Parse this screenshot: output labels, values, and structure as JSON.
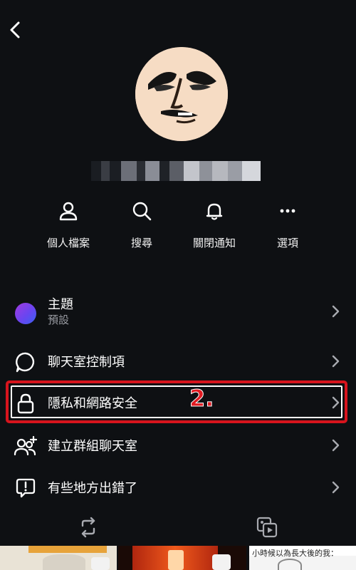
{
  "header": {
    "back_icon": "chevron-left-icon"
  },
  "profile": {
    "name": ""
  },
  "actions": [
    {
      "label": "個人檔案",
      "icon": "person-icon"
    },
    {
      "label": "搜尋",
      "icon": "search-icon"
    },
    {
      "label": "關閉通知",
      "icon": "bell-icon"
    },
    {
      "label": "選項",
      "icon": "more-icon"
    }
  ],
  "menu": {
    "theme": {
      "label": "主題",
      "sub": "預設"
    },
    "chat_controls": {
      "label": "聊天室控制項"
    },
    "privacy": {
      "label": "隱私和網路安全"
    },
    "create_group": {
      "label": "建立群組聊天室"
    },
    "report": {
      "label": "有些地方出錯了"
    }
  },
  "annotation": {
    "step": "2.",
    "color": "#d7141d"
  },
  "bottom_bar": {
    "icons": [
      "repeat-icon",
      "media-icon"
    ]
  },
  "thumbnails": [
    {
      "caption": ""
    },
    {
      "caption": ""
    },
    {
      "caption": "小時候以為長大後的我："
    }
  ],
  "colors": {
    "background": "#0e1013",
    "highlight": "#d7141d",
    "chevron": "#a8aab0"
  }
}
